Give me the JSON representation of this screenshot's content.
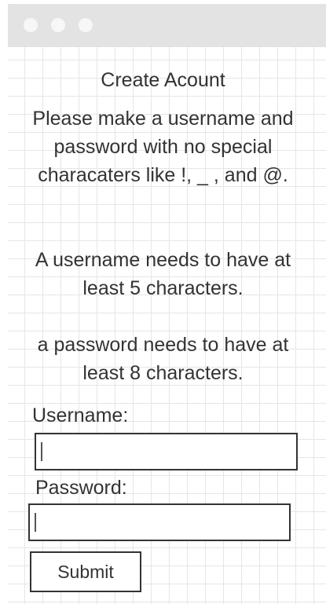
{
  "window": {
    "controls": [
      "close",
      "minimize",
      "maximize"
    ]
  },
  "form": {
    "title": "Create Acount",
    "instructions": [
      "Please make a username and password with no special characaters like !, _ , and @.",
      "A username needs to have at least 5 characters.",
      "a password needs to have at least 8 characters."
    ],
    "username_label": "Username:",
    "username_value": "",
    "password_label": "Password:",
    "password_value": "",
    "submit_label": "Submit"
  },
  "colors": {
    "titlebar": "#e3e3e3",
    "grid": "#e6e6e6",
    "text": "#333333",
    "border": "#333333"
  }
}
